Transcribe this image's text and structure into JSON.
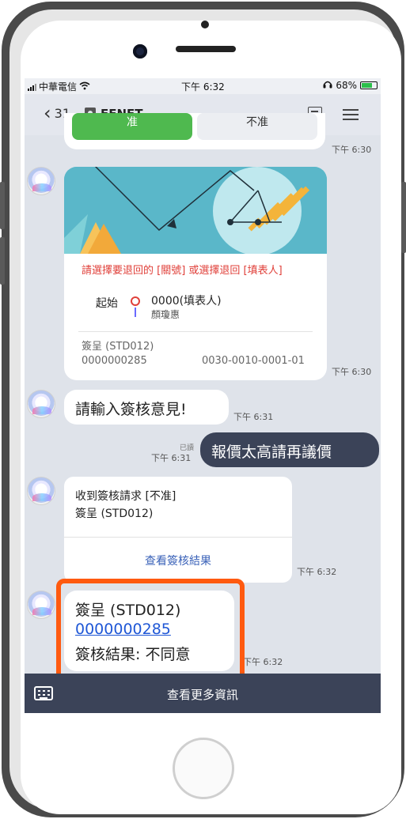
{
  "status": {
    "carrier": "中華電信",
    "time": "下午 6:32",
    "battery": "68%"
  },
  "nav": {
    "back_count": "31",
    "title": "EFNET"
  },
  "top_card": {
    "approve": "准",
    "reject": "不准",
    "time": "下午 6:30"
  },
  "flow_card": {
    "heading": "請選擇要退回的 [關號] 或選擇退回 [填表人]",
    "start_label": "起始",
    "node": "0000(填表人)",
    "node_sub": "顏瓊惠",
    "doc": "簽呈 (STD012)",
    "doc_no": "0000000285",
    "code": "0030-0010-0001-01",
    "time": "下午 6:30"
  },
  "ask": {
    "text": "請輸入簽核意見!",
    "time": "下午 6:31"
  },
  "reply": {
    "text": "報價太高請再議價",
    "read": "已讀",
    "time": "下午 6:31"
  },
  "receive_card": {
    "line1": "收到簽核請求 [不准]",
    "line2": "簽呈 (STD012)",
    "link": "查看簽核結果",
    "time": "下午 6:32"
  },
  "result_card": {
    "line1": "簽呈 (STD012)",
    "link": "0000000285",
    "line3": "簽核結果: 不同意",
    "time": "下午 6:32"
  },
  "bottom": {
    "more": "查看更多資訊"
  },
  "colors": {
    "accent": "#ff5a10",
    "approve": "#4fb94f",
    "dark": "#3b4358",
    "link": "#1f57d6"
  }
}
